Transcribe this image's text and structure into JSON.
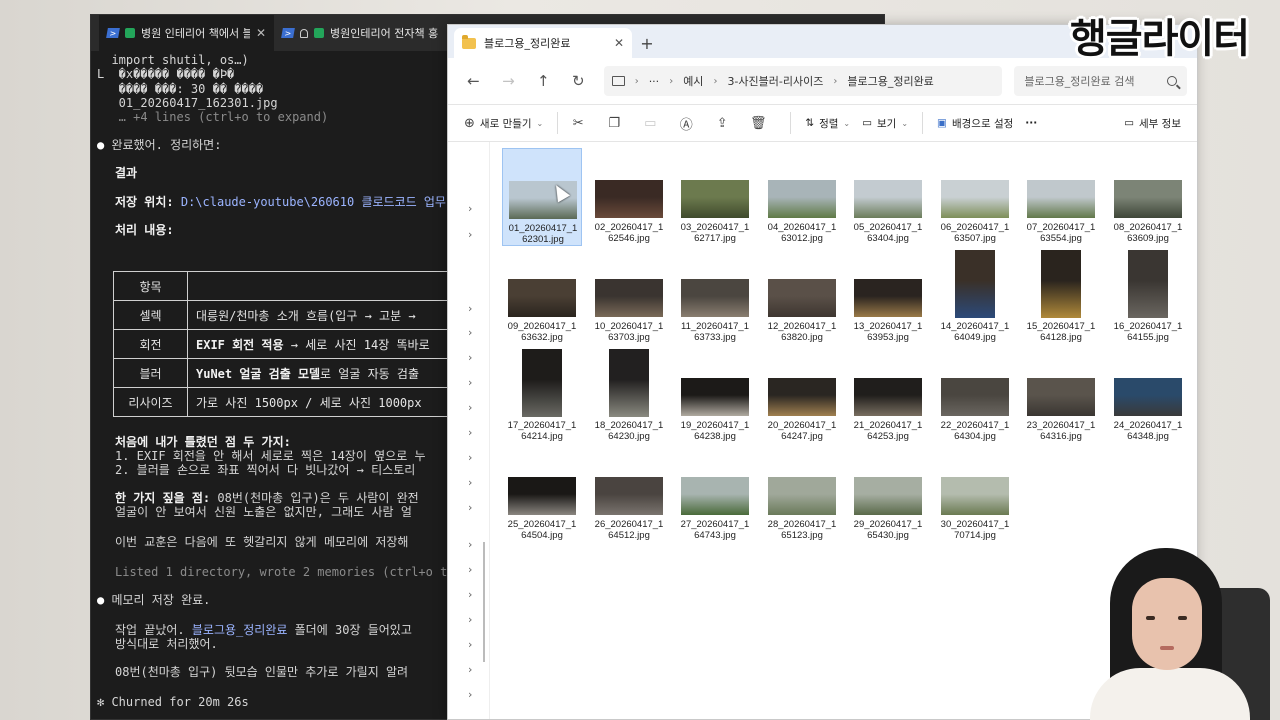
{
  "terminal": {
    "tabs": [
      {
        "label": "병원 인테리어 책에서 블로"
      },
      {
        "label": "병원인테리어 전자책 홍"
      }
    ],
    "lines": {
      "import": "  import shutil, os…)",
      "garbled1": "L  �x����� ���� �Þ�",
      "garbled2": "   ���� ���: 30 �� ����",
      "file": "   01_20260417_162301.jpg",
      "expand": "   … +4 lines (ctrl+o to expand)",
      "done": "완료했어. 정리하면:",
      "result": "결과",
      "save_label": "저장 위치: ",
      "save_path": "D:\\claude-youtube\\260610 클로드코드 업무",
      "process": "처리 내용:",
      "mistakes_title": "처음에 내가 틀렸던 점 두 가지:",
      "mistake1": "1. EXIF 회전을 안 해서 세로로 찍은 14장이 옆으로 누",
      "mistake2": "2. 블러를 손으로 좌표 찍어서 다 빗나갔어 → 티스토리",
      "note_bold": "한 가지 짚을 점:",
      "note_rest": " 08번(천마총 입구)은 두 사람이 완전",
      "note2": "얼굴이 안 보여서 신원 노출은 없지만, 그래도 사람 얼",
      "lesson": "이번 교훈은 다음에 또 헷갈리지 않게 메모리에 저장해",
      "listed": "Listed 1 directory, wrote 2 memories (ctrl+o to ex",
      "memory_done": "메모리 저장 완료.",
      "work_pre": "작업 끝났어. ",
      "work_folder": "블로그용_정리완료",
      "work_post": " 폴더에 30장 들어있고",
      "work2": "방식대로 처리했어.",
      "last": "08번(천마총 입구) 뒷모습 인물만 추가로 가릴지 알려",
      "churned": "✻ Churned for 20m 26s"
    },
    "table": {
      "header": [
        "항목",
        ""
      ],
      "rows": [
        {
          "k": "셀렉",
          "v": "대릉원/천마총 소개 흐름(입구 → 고분 →"
        },
        {
          "k": "회전",
          "v_bold": "EXIF 회전 적용",
          "v": " → 세로 사진 14장 똑바로"
        },
        {
          "k": "블러",
          "v_bold": "YuNet 얼굴 검출 모델",
          "v": "로 얼굴 자동 검출"
        },
        {
          "k": "리사이즈",
          "v": "가로 사진 1500px / 세로 사진 1000px"
        }
      ]
    }
  },
  "explorer": {
    "tab_title": "블로그용_정리완료",
    "breadcrumb": [
      "예시",
      "3-사진블러-리사이즈",
      "블로그용_정리완료"
    ],
    "search_placeholder": "블로그용_정리완료 검색",
    "commands": {
      "new": "새로 만들기",
      "sort": "정렬",
      "view": "보기",
      "set_bg": "배경으로 설정",
      "details": "세부 정보"
    },
    "files": [
      {
        "l1": "01_20260417_1",
        "l2": "62301.jpg",
        "sky": "#b9c6cf",
        "ground": "#5b6a55"
      },
      {
        "l1": "02_20260417_1",
        "l2": "62546.jpg",
        "sky": "#3a2a24",
        "ground": "#6a4a3a"
      },
      {
        "l1": "03_20260417_1",
        "l2": "62717.jpg",
        "sky": "#6c7a4e",
        "ground": "#3f4a2c"
      },
      {
        "l1": "04_20260417_1",
        "l2": "63012.jpg",
        "sky": "#a8b4b8",
        "ground": "#5f7a46"
      },
      {
        "l1": "05_20260417_1",
        "l2": "63404.jpg",
        "sky": "#c3cbd0",
        "ground": "#6b7c5a"
      },
      {
        "l1": "06_20260417_1",
        "l2": "63507.jpg",
        "sky": "#c9d0d3",
        "ground": "#7d8e58"
      },
      {
        "l1": "07_20260417_1",
        "l2": "63554.jpg",
        "sky": "#c0c8cc",
        "ground": "#62784a"
      },
      {
        "l1": "08_20260417_1",
        "l2": "63609.jpg",
        "sky": "#7c8476",
        "ground": "#3e4638"
      },
      {
        "l1": "09_20260417_1",
        "l2": "63632.jpg",
        "sky": "#4a3f34",
        "ground": "#2a241e"
      },
      {
        "l1": "10_20260417_1",
        "l2": "63703.jpg",
        "sky": "#3a3430",
        "ground": "#7a6a58"
      },
      {
        "l1": "11_20260417_1",
        "l2": "63733.jpg",
        "sky": "#4b4640",
        "ground": "#8a7e70"
      },
      {
        "l1": "12_20260417_1",
        "l2": "63820.jpg",
        "sky": "#5a5048",
        "ground": "#3e3630"
      },
      {
        "l1": "13_20260417_1",
        "l2": "63953.jpg",
        "sky": "#2a2420",
        "ground": "#9a7a48"
      },
      {
        "l1": "14_20260417_1",
        "l2": "64049.jpg",
        "sky": "#3a3028",
        "ground": "#2c4a7a"
      },
      {
        "l1": "15_20260417_1",
        "l2": "64128.jpg",
        "sky": "#2a241e",
        "ground": "#b08a3a"
      },
      {
        "l1": "16_20260417_1",
        "l2": "64155.jpg",
        "sky": "#3a3632",
        "ground": "#6a6660"
      },
      {
        "l1": "17_20260417_1",
        "l2": "64214.jpg",
        "sky": "#1e1c1a",
        "ground": "#6a6a64"
      },
      {
        "l1": "18_20260417_1",
        "l2": "64230.jpg",
        "sky": "#222020",
        "ground": "#8a8a80"
      },
      {
        "l1": "19_20260417_1",
        "l2": "64238.jpg",
        "sky": "#1c1a18",
        "ground": "#b0aaa0"
      },
      {
        "l1": "20_20260417_1",
        "l2": "64247.jpg",
        "sky": "#2a2622",
        "ground": "#a08050"
      },
      {
        "l1": "21_20260417_1",
        "l2": "64253.jpg",
        "sky": "#201e1c",
        "ground": "#786e60"
      },
      {
        "l1": "22_20260417_1",
        "l2": "64304.jpg",
        "sky": "#4a4640",
        "ground": "#6a6660"
      },
      {
        "l1": "23_20260417_1",
        "l2": "64316.jpg",
        "sky": "#5a544c",
        "ground": "#3a3632"
      },
      {
        "l1": "24_20260417_1",
        "l2": "64348.jpg",
        "sky": "#2a4a6a",
        "ground": "#3a3a3a"
      },
      {
        "l1": "25_20260417_1",
        "l2": "64504.jpg",
        "sky": "#1a1816",
        "ground": "#8a8680"
      },
      {
        "l1": "26_20260417_1",
        "l2": "64512.jpg",
        "sky": "#4a4440",
        "ground": "#7a746e"
      },
      {
        "l1": "27_20260417_1",
        "l2": "64743.jpg",
        "sky": "#a8b4b0",
        "ground": "#4a6a3a"
      },
      {
        "l1": "28_20260417_1",
        "l2": "65123.jpg",
        "sky": "#a0a89a",
        "ground": "#6a7a5a"
      },
      {
        "l1": "29_20260417_1",
        "l2": "65430.jpg",
        "sky": "#a6aea2",
        "ground": "#5a6a4a"
      },
      {
        "l1": "30_20260417_1",
        "l2": "70714.jpg",
        "sky": "#b4bcae",
        "ground": "#6a7a52"
      }
    ]
  },
  "overlay": {
    "logo": "행글라이터"
  }
}
